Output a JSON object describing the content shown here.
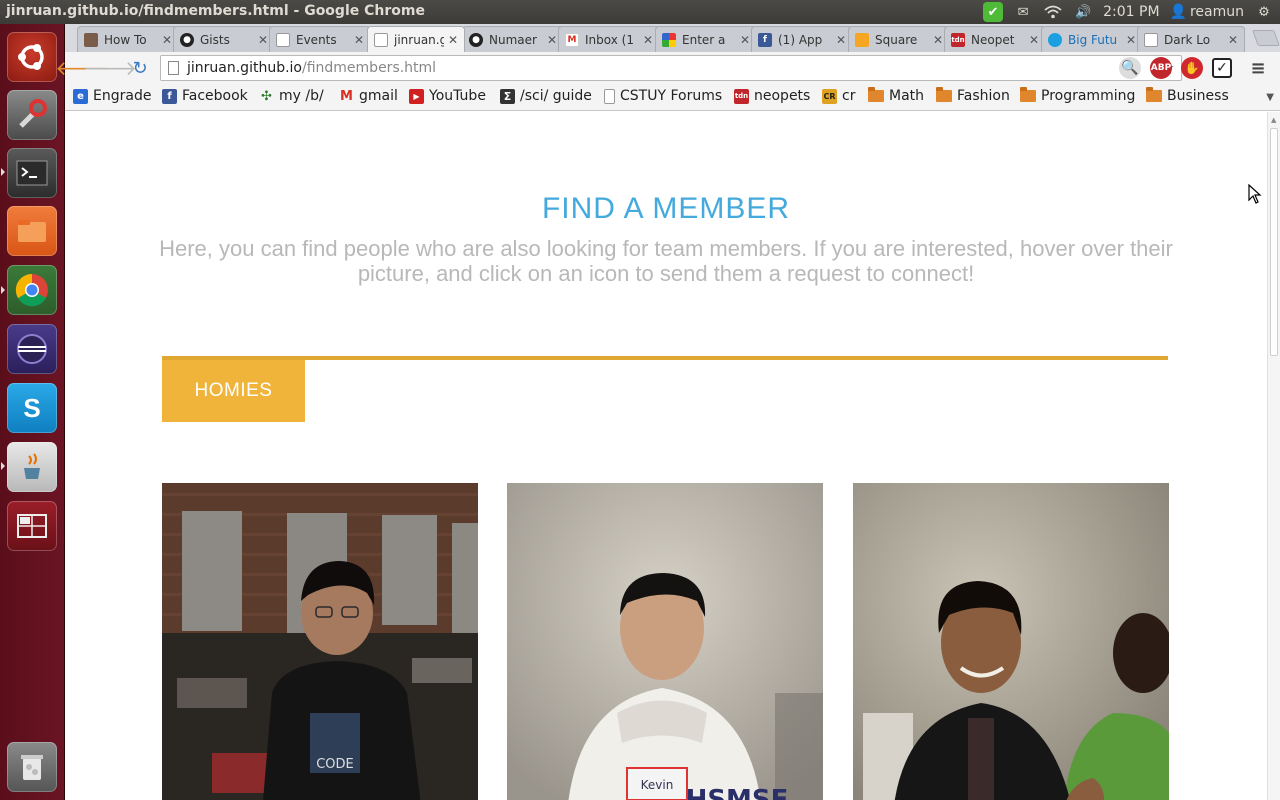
{
  "window": {
    "title": "jinruan.github.io/findmembers.html - Google Chrome"
  },
  "system_tray": {
    "time": "2:01 PM",
    "user": "reamun"
  },
  "launcher": {
    "items": [
      "ubuntu-dash",
      "system-settings",
      "terminal",
      "files",
      "chrome",
      "eclipse",
      "skype",
      "java",
      "workspace-switcher",
      "trash"
    ]
  },
  "tabs": [
    {
      "label": "How To",
      "favicon": "person-photo-icon"
    },
    {
      "label": "Gists",
      "favicon": "github-icon"
    },
    {
      "label": "Events",
      "favicon": "page-icon"
    },
    {
      "label": "jinruan.g",
      "favicon": "page-icon",
      "active": true
    },
    {
      "label": "Numaer",
      "favicon": "github-icon"
    },
    {
      "label": "Inbox (1",
      "favicon": "gmail-icon"
    },
    {
      "label": "Enter a",
      "favicon": "pinwheel-icon"
    },
    {
      "label": "(1) App",
      "favicon": "facebook-icon"
    },
    {
      "label": "Square",
      "favicon": "square-icon"
    },
    {
      "label": "Neopet",
      "favicon": "tdn-icon"
    },
    {
      "label": "Big Futu",
      "favicon": "bubble-icon"
    },
    {
      "label": "Dark Lo",
      "favicon": "page-icon"
    }
  ],
  "address_bar": {
    "host": "jinruan.github.io",
    "path": "/findmembers.html"
  },
  "bookmarks": [
    {
      "label": "Engrade",
      "icon": "engrade-icon"
    },
    {
      "label": "Facebook",
      "icon": "facebook-icon"
    },
    {
      "label": "my /b/",
      "icon": "clover-icon"
    },
    {
      "label": "gmail",
      "icon": "gmail-icon"
    },
    {
      "label": "YouTube",
      "icon": "youtube-icon"
    },
    {
      "label": "/sci/ guide",
      "icon": "sigma-icon"
    },
    {
      "label": "CSTUY Forums",
      "icon": "page-icon"
    },
    {
      "label": "neopets",
      "icon": "tdn-icon"
    },
    {
      "label": "cr",
      "icon": "cr-icon"
    },
    {
      "label": "Math",
      "icon": "folder-icon"
    },
    {
      "label": "Fashion",
      "icon": "folder-icon"
    },
    {
      "label": "Programming",
      "icon": "folder-icon"
    },
    {
      "label": "Business",
      "icon": "folder-icon"
    }
  ],
  "page": {
    "heading": "FIND A MEMBER",
    "intro": "Here, you can find people who are also looking for team members. If you are interested, hover over their picture, and click on an icon to send them a request to connect!",
    "tab_label": "HOMIES",
    "accent_color": "#e0a831",
    "heading_color": "#44a9dc",
    "members": [
      {
        "photo": "member-photo-1"
      },
      {
        "photo": "member-photo-2",
        "name_tag": "Kevin",
        "shirt_text": "HSMSE"
      },
      {
        "photo": "member-photo-3"
      }
    ]
  }
}
